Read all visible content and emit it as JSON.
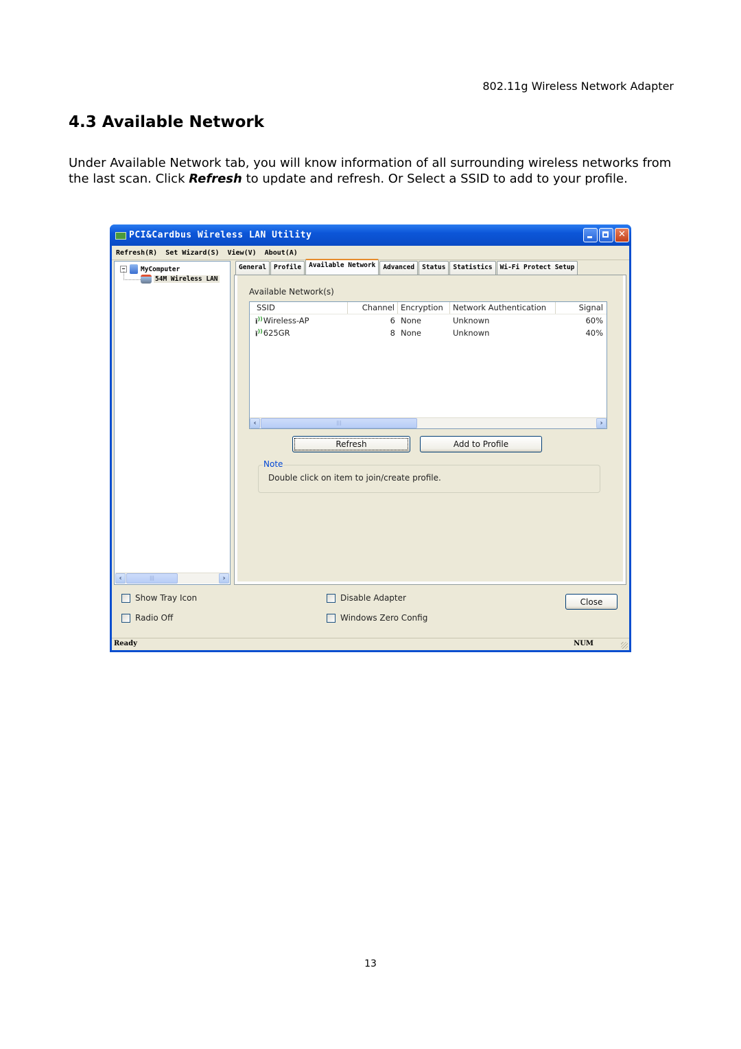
{
  "page": {
    "header_right": "802.11g Wireless Network Adapter",
    "section_title": "4.3 Available Network",
    "paragraph": {
      "before": "Under Available Network tab, you will know information of all surrounding wireless networks from the last scan.   Click ",
      "bold": "Refresh",
      "after": " to update and refresh. Or Select a SSID to add to your profile."
    },
    "page_number": "13"
  },
  "window": {
    "title": "PCI&Cardbus Wireless LAN Utility",
    "menu": [
      "Refresh(R)",
      "Set Wizard(S)",
      "View(V)",
      "About(A)"
    ],
    "tree": {
      "root": "MyComputer",
      "child": "54M Wireless LAN"
    },
    "tabs": [
      {
        "label": "General",
        "active": false
      },
      {
        "label": "Profile",
        "active": false
      },
      {
        "label": "Available Network",
        "active": true
      },
      {
        "label": "Advanced",
        "active": false
      },
      {
        "label": "Status",
        "active": false
      },
      {
        "label": "Statistics",
        "active": false
      },
      {
        "label": "Wi-Fi Protect Setup",
        "active": false
      }
    ],
    "available": {
      "group_title": "Available Network(s)",
      "columns": [
        "SSID",
        "Channel",
        "Encryption",
        "Network Authentication",
        "Signal"
      ],
      "rows": [
        {
          "ssid": "Wireless-AP",
          "channel": "6",
          "encryption": "None",
          "auth": "Unknown",
          "signal": "60%"
        },
        {
          "ssid": "625GR",
          "channel": "8",
          "encryption": "None",
          "auth": "Unknown",
          "signal": "40%"
        }
      ],
      "refresh_label": "Refresh",
      "add_profile_label": "Add to Profile",
      "note_title": "Note",
      "note_text": "Double click on item to join/create profile."
    },
    "options": {
      "show_tray_icon": "Show Tray Icon",
      "radio_off": "Radio Off",
      "disable_adapter": "Disable Adapter",
      "windows_zero_config": "Windows Zero Config",
      "close_label": "Close"
    },
    "status": {
      "text": "Ready",
      "num": "NUM"
    }
  }
}
